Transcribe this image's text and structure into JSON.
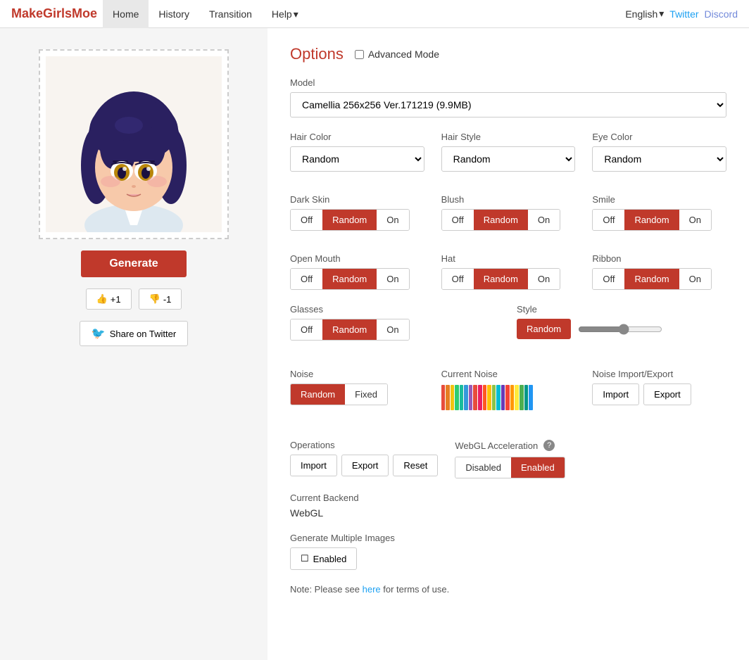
{
  "app": {
    "brand": "MakeGirlsMoe"
  },
  "nav": {
    "links": [
      {
        "id": "home",
        "label": "Home",
        "active": true
      },
      {
        "id": "history",
        "label": "History",
        "active": false
      },
      {
        "id": "transition",
        "label": "Transition",
        "active": false
      },
      {
        "id": "help",
        "label": "Help",
        "active": false
      }
    ],
    "lang": "English",
    "twitter": "Twitter",
    "discord": "Discord"
  },
  "left": {
    "generate_label": "Generate",
    "upvote_label": "+1",
    "downvote_label": "-1",
    "twitter_share": "Share on Twitter"
  },
  "options": {
    "title": "Options",
    "advanced_mode_label": "Advanced Mode",
    "model_label": "Model",
    "model_value": "Camellia 256x256 Ver.171219 (9.9MB)",
    "hair_color_label": "Hair Color",
    "hair_color_value": "Random",
    "hair_style_label": "Hair Style",
    "hair_style_value": "Random",
    "eye_color_label": "Eye Color",
    "eye_color_value": "Random",
    "dark_skin_label": "Dark Skin",
    "blush_label": "Blush",
    "smile_label": "Smile",
    "open_mouth_label": "Open Mouth",
    "hat_label": "Hat",
    "ribbon_label": "Ribbon",
    "glasses_label": "Glasses",
    "style_label": "Style",
    "noise_label": "Noise",
    "current_noise_label": "Current Noise",
    "noise_import_export_label": "Noise Import/Export",
    "operations_label": "Operations",
    "webgl_label": "WebGL Acceleration",
    "current_backend_label": "Current Backend",
    "current_backend_value": "WebGL",
    "generate_multiple_label": "Generate Multiple Images",
    "note_text": "Note: Please see ",
    "note_link": "here",
    "note_suffix": " for terms of use.",
    "toggle_off": "Off",
    "toggle_random": "Random",
    "toggle_on": "On",
    "toggle_fixed": "Fixed",
    "toggle_disabled": "Disabled",
    "toggle_enabled": "Enabled",
    "import_label": "Import",
    "export_label": "Export",
    "reset_label": "Reset",
    "enabled_label": "Enabled"
  },
  "noise_bars": [
    {
      "color": "#e74c3c"
    },
    {
      "color": "#e67e22"
    },
    {
      "color": "#f1c40f"
    },
    {
      "color": "#2ecc71"
    },
    {
      "color": "#1abc9c"
    },
    {
      "color": "#3498db"
    },
    {
      "color": "#9b59b6"
    },
    {
      "color": "#e74c3c"
    },
    {
      "color": "#e91e63"
    },
    {
      "color": "#ff5722"
    },
    {
      "color": "#ffc107"
    },
    {
      "color": "#8bc34a"
    },
    {
      "color": "#00bcd4"
    },
    {
      "color": "#673ab7"
    },
    {
      "color": "#f44336"
    },
    {
      "color": "#ff9800"
    },
    {
      "color": "#ffeb3b"
    },
    {
      "color": "#4caf50"
    },
    {
      "color": "#009688"
    },
    {
      "color": "#2196f3"
    }
  ]
}
